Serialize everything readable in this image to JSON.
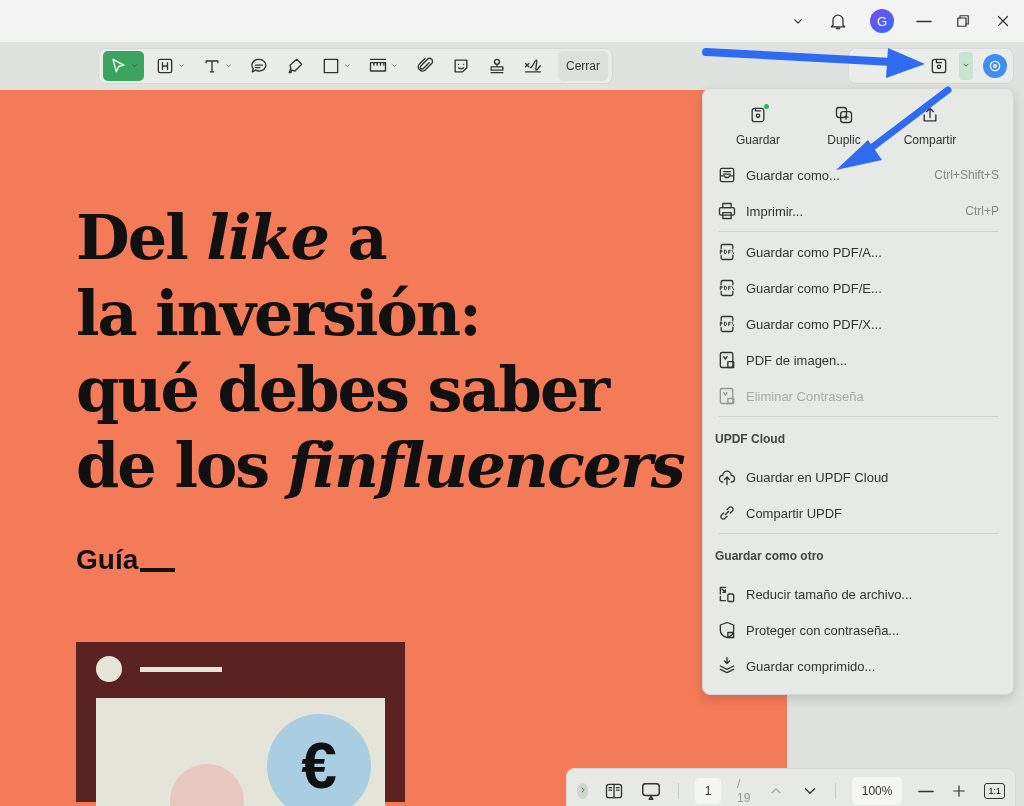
{
  "title_bar": {
    "avatar_letter": "G"
  },
  "toolbar": {
    "tools": [
      {
        "selected": true,
        "dropdown": true
      },
      {
        "selected": false,
        "dropdown": true
      },
      {
        "selected": false,
        "dropdown": true
      },
      {
        "selected": false,
        "dropdown": false
      },
      {
        "selected": false,
        "dropdown": false
      },
      {
        "selected": false,
        "dropdown": true
      },
      {
        "selected": false,
        "dropdown": true
      },
      {
        "selected": false,
        "dropdown": false
      },
      {
        "selected": false,
        "dropdown": false
      },
      {
        "selected": false,
        "dropdown": false
      },
      {
        "selected": false,
        "dropdown": false
      }
    ],
    "close_label": "Cerrar"
  },
  "document": {
    "title_lines": [
      "Del *like* a",
      "la inversión:",
      "qué debes saber",
      "de los *finfluencers*"
    ],
    "subtitle": "Guía",
    "illustration_symbol": "€"
  },
  "menu": {
    "actions": [
      {
        "label": "Guardar",
        "badge": true
      },
      {
        "label": "Duplic",
        "badge": false
      },
      {
        "label": "Compartir",
        "badge": false
      }
    ],
    "entries": [
      {
        "kind": "item",
        "label": "Guardar como...",
        "shortcut": "Ctrl+Shift+S",
        "disabled": false
      },
      {
        "kind": "item",
        "label": "Imprimir...",
        "shortcut": "Ctrl+P",
        "disabled": false
      },
      {
        "kind": "divider"
      },
      {
        "kind": "item",
        "label": "Guardar como PDF/A...",
        "disabled": false
      },
      {
        "kind": "item",
        "label": "Guardar como PDF/E...",
        "disabled": false
      },
      {
        "kind": "item",
        "label": "Guardar como PDF/X...",
        "disabled": false
      },
      {
        "kind": "item",
        "label": "PDF de imagen...",
        "disabled": false
      },
      {
        "kind": "item",
        "label": "Eliminar Contraseña",
        "disabled": true
      },
      {
        "kind": "divider"
      },
      {
        "kind": "header",
        "label": "UPDF Cloud"
      },
      {
        "kind": "item",
        "label": "Guardar en UPDF Cloud",
        "disabled": false
      },
      {
        "kind": "item",
        "label": "Compartir UPDF",
        "disabled": false
      },
      {
        "kind": "divider"
      },
      {
        "kind": "header",
        "label": "Guardar como otro"
      },
      {
        "kind": "item",
        "label": "Reducir tamaño de archivo...",
        "disabled": false
      },
      {
        "kind": "item",
        "label": "Proteger con contraseña...",
        "disabled": false
      },
      {
        "kind": "item",
        "label": "Guardar comprimido...",
        "disabled": false
      }
    ]
  },
  "bottom_bar": {
    "page": "1",
    "page_total": "/ 19",
    "zoom": "100%",
    "actual_size": "1:1"
  }
}
